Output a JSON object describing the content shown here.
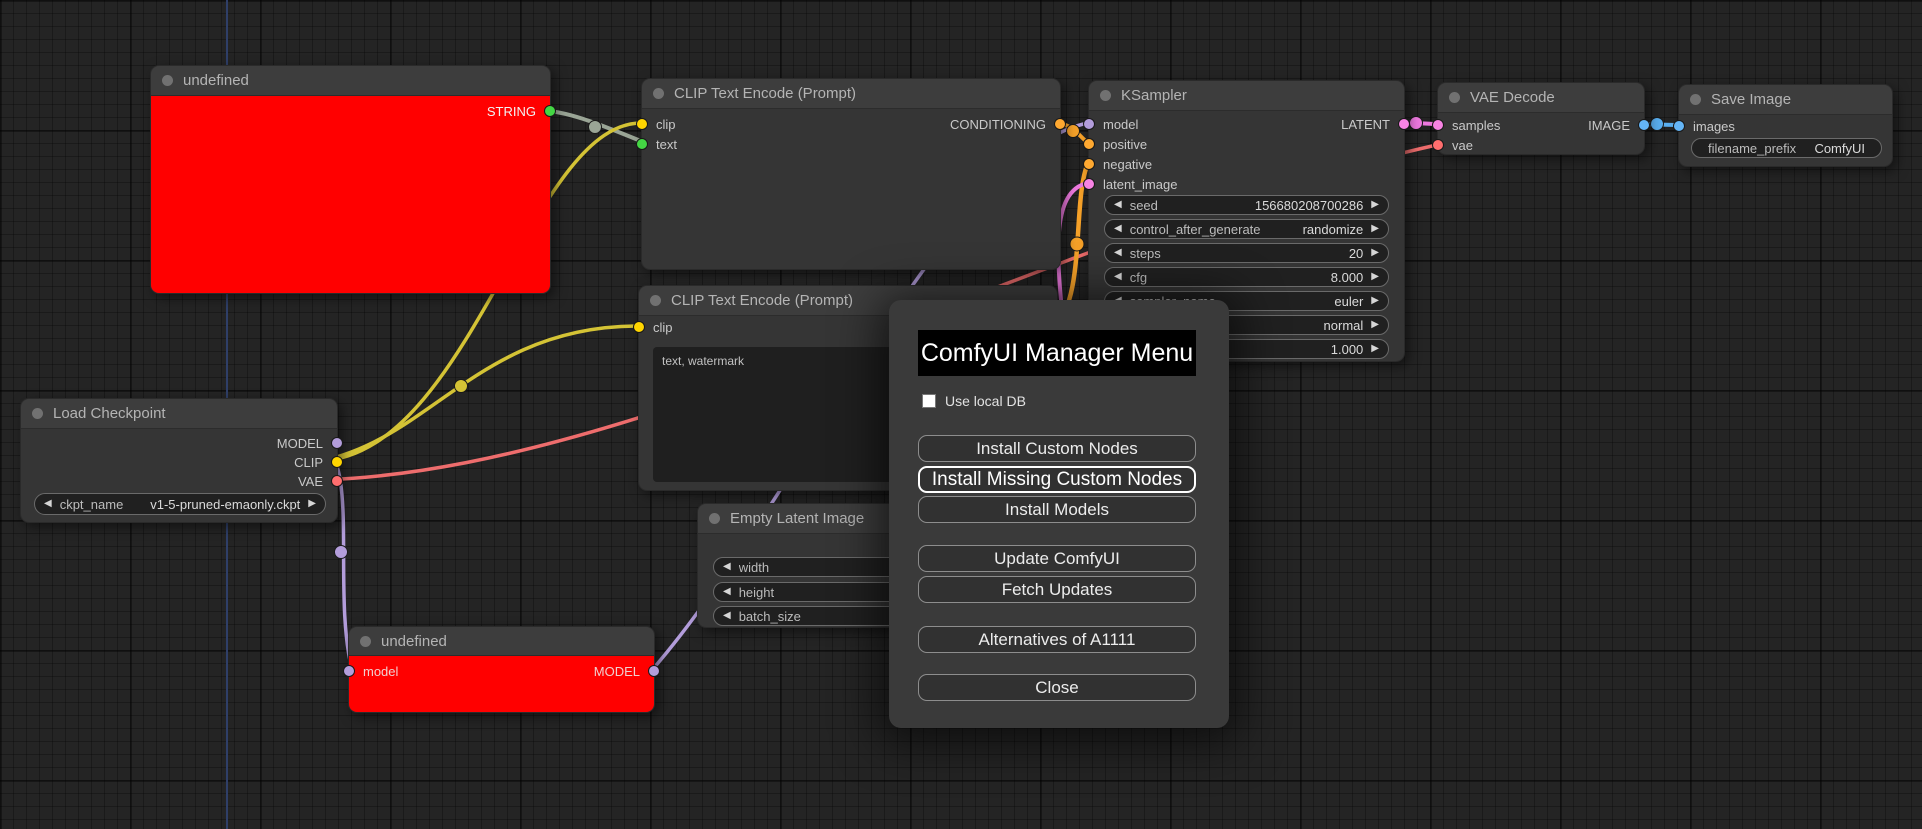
{
  "icons": {
    "left_arrow": "◀",
    "right_arrow": "▶"
  },
  "colors": {
    "model": "#b39ddb",
    "clip": "#ffd500",
    "vae": "#ff6e6e",
    "conditioning": "#ffa931",
    "latent": "#f783e3",
    "image": "#64b5f6",
    "string": "#44d644",
    "node_error_body": "#ff0000",
    "node_body": "#353535",
    "node_header": "#3d3d3d",
    "canvas_background": "#242424",
    "dialog_background": "#3a3a3a"
  },
  "nodes": {
    "undefined_top": {
      "title": "undefined",
      "output": "STRING"
    },
    "clip_encode_1": {
      "title": "CLIP Text Encode (Prompt)",
      "inputs": [
        "clip",
        "text"
      ],
      "output": "CONDITIONING"
    },
    "ksampler": {
      "title": "KSampler",
      "inputs": [
        "model",
        "positive",
        "negative",
        "latent_image"
      ],
      "output": "LATENT",
      "widgets": [
        {
          "label": "seed",
          "value": "156680208700286"
        },
        {
          "label": "control_after_generate",
          "value": "randomize"
        },
        {
          "label": "steps",
          "value": "20"
        },
        {
          "label": "cfg",
          "value": "8.000"
        },
        {
          "label": "sampler_name",
          "value": "euler"
        },
        {
          "label": "",
          "value": "normal"
        },
        {
          "label": "",
          "value": "1.000"
        }
      ]
    },
    "vae_decode": {
      "title": "VAE Decode",
      "inputs": [
        "samples",
        "vae"
      ],
      "output": "IMAGE"
    },
    "save_image": {
      "title": "Save Image",
      "inputs": [
        "images"
      ],
      "widgets": [
        {
          "label": "filename_prefix",
          "value": "ComfyUI"
        }
      ]
    },
    "clip_encode_2": {
      "title": "CLIP Text Encode (Prompt)",
      "inputs": [
        "clip"
      ],
      "prompt_text": "text, watermark"
    },
    "empty_latent": {
      "title": "Empty Latent Image",
      "widgets": [
        {
          "label": "width"
        },
        {
          "label": "height"
        },
        {
          "label": "batch_size"
        }
      ]
    },
    "load_checkpoint": {
      "title": "Load Checkpoint",
      "outputs": [
        "MODEL",
        "CLIP",
        "VAE"
      ],
      "widgets": [
        {
          "label": "ckpt_name",
          "value": "v1-5-pruned-emaonly.ckpt"
        }
      ]
    },
    "undefined_bottom": {
      "title": "undefined",
      "inputs": [
        "model"
      ],
      "output": "MODEL"
    }
  },
  "manager_menu": {
    "title": "ComfyUI Manager Menu",
    "checkbox_label": "Use local DB",
    "buttons": [
      "Install Custom Nodes",
      "Install Missing Custom Nodes",
      "Install Models",
      "Update ComfyUI",
      "Fetch Updates",
      "Alternatives of A1111",
      "Close"
    ]
  }
}
